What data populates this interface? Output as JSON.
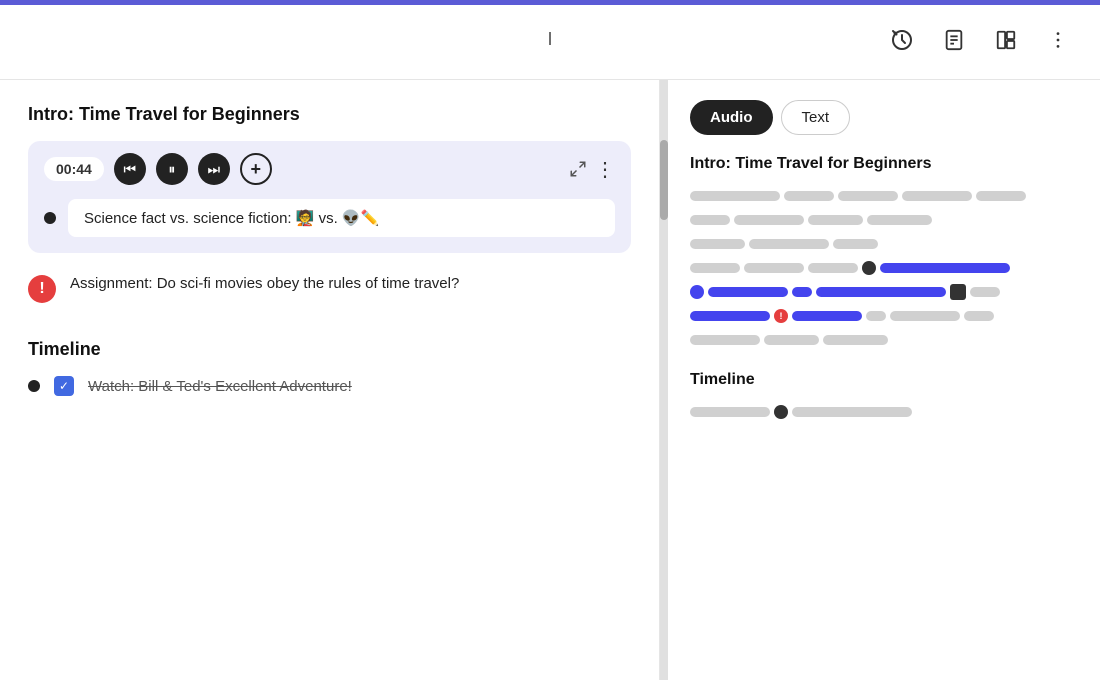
{
  "topbar": {
    "cursor_icon": "I",
    "history_icon": "⏱",
    "document_icon": "📄",
    "layout_icon": "⊞",
    "more_icon": "⋮"
  },
  "left": {
    "section1_title": "Intro: Time Travel for Beginners",
    "audio_time": "00:44",
    "audio_item_text": "Science fact vs. science fiction: 🧑‍🏫 vs. 👽✏️",
    "assignment_text": "Assignment: Do sci-fi movies obey the rules of time travel?",
    "section2_title": "Timeline",
    "timeline_item_text": "Watch: Bill & Ted's Excellent Adventure!"
  },
  "right": {
    "tab_audio": "Audio",
    "tab_text": "Text",
    "section1_title": "Intro: Time Travel for Beginners",
    "section2_title": "Timeline",
    "waveform_rows": [
      {
        "type": "gray_only",
        "segs": [
          100,
          60,
          70,
          80,
          60
        ]
      },
      {
        "type": "gray_only",
        "segs": [
          50,
          80,
          60,
          70
        ]
      },
      {
        "type": "gray_only",
        "segs": [
          60,
          90,
          50
        ]
      },
      {
        "type": "dot_blue_then_blue",
        "dot": "dark",
        "seg1_gray": 40,
        "seg2_blue": 120
      },
      {
        "type": "blue_full",
        "dot": "blue",
        "seg1_blue": 80,
        "seg2_blue": 150,
        "dot2": "dark"
      },
      {
        "type": "blue_error",
        "dot_red": true,
        "seg1_blue": 80,
        "seg2_gray": 80
      },
      {
        "type": "gray_only",
        "segs": [
          80,
          60,
          70
        ]
      }
    ],
    "timeline_waverow": {
      "dot": "dark",
      "seg_gray": 120
    }
  }
}
